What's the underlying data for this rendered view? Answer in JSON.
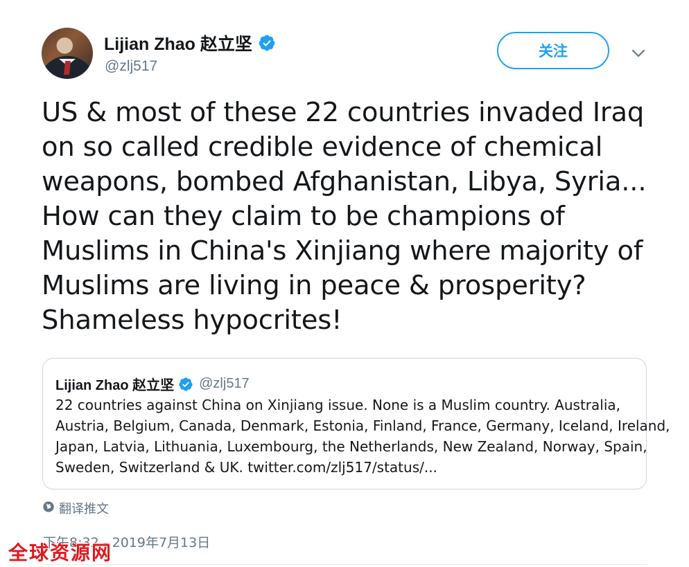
{
  "tweet": {
    "author": {
      "display_name": "Lijian Zhao 赵立坚",
      "handle": "@zlj517",
      "verified": true,
      "avatar_icon": "profile-photo"
    },
    "follow_label": "关注",
    "menu_icon": "chevron-down-icon",
    "text_lines": [
      "US & most of these 22 countries invaded Iraq",
      "on so called credible evidence of chemical",
      "weapons, bombed Afghanistan, Libya, Syria...",
      "How can they claim to be champions of",
      "Muslims in China's Xinjiang where majority of",
      "Muslims are living in peace & prosperity?",
      "Shameless hypocrites!"
    ],
    "translate_label": "翻译推文",
    "translate_icon": "globe-icon",
    "timestamp": "下午8:32 - 2019年7月13日"
  },
  "quoted_tweet": {
    "display_name": "Lijian Zhao 赵立坚",
    "handle": "@zlj517",
    "verified": true,
    "text_lines": [
      "22 countries against China on Xinjiang issue. None is a Muslim country. Australia,",
      "Austria, Belgium, Canada, Denmark, Estonia, Finland, France, Germany, Iceland, Ireland,",
      "Japan, Latvia, Lithuania, Luxembourg, the Netherlands, New Zealand, Norway, Spain,",
      "Sweden, Switzerland & UK. twitter.com/zlj517/status/..."
    ]
  },
  "watermark": "全球资源网",
  "colors": {
    "accent": "#1da1f2",
    "text": "#14171a",
    "secondary_text": "#657786",
    "border": "#ccd6dd",
    "watermark": "#e0191f"
  }
}
